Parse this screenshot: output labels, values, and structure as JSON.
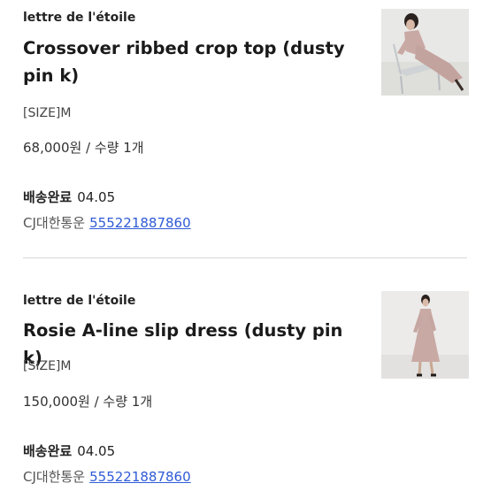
{
  "orders": [
    {
      "brand": "lettre de l'étoile",
      "title": "Crossover ribbed crop top (dusty pin k)",
      "size": "[SIZE]M",
      "price_qty": "68,000원 / 수량 1개",
      "shipping_status_label": "배송완료",
      "shipping_date": "04.05",
      "carrier": "CJ대한통운",
      "tracking_number": "555221887860",
      "thumbnail_icon": "product-photo-icon"
    },
    {
      "brand": "lettre de l'étoile",
      "title": "Rosie A-line slip dress (dusty pink)",
      "size": "[SIZE]M",
      "price_qty": "150,000원 / 수량 1개",
      "shipping_status_label": "배송완료",
      "shipping_date": "04.05",
      "carrier": "CJ대한통운",
      "tracking_number": "555221887860",
      "thumbnail_icon": "product-photo-icon"
    }
  ],
  "colors": {
    "tracking_link": "#2f5bd6",
    "divider": "#d9d9d9",
    "dusty_pink": "#c9a9a4"
  }
}
